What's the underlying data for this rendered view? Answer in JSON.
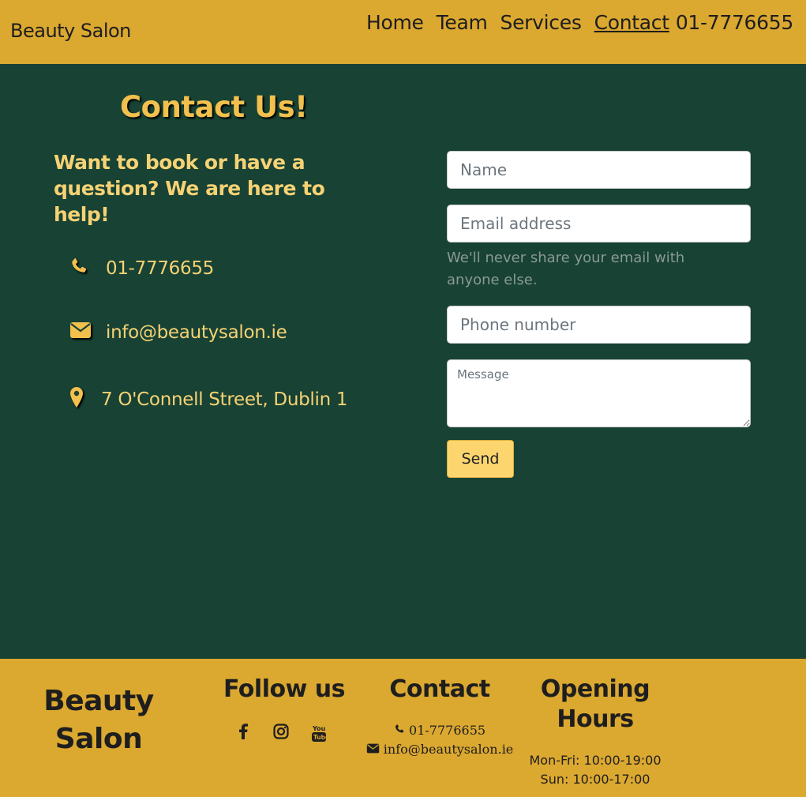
{
  "nav": {
    "brand": "Beauty Salon",
    "links": [
      "Home",
      "Team",
      "Services",
      "Contact"
    ],
    "active": "Contact",
    "phone": "01-7776655"
  },
  "main": {
    "title": "Contact Us!",
    "tagline": "Want to book or have a question? We are here to help!",
    "phone": "01-7776655",
    "email": "info@beautysalon.ie",
    "address": "7 O'Connell Street, Dublin 1",
    "icons": [
      "phone-icon",
      "envelope-icon",
      "map-marker-icon"
    ]
  },
  "form": {
    "name_placeholder": "Name",
    "email_placeholder": "Email address",
    "email_help": "We'll never share your email with anyone else.",
    "phone_placeholder": "Phone number",
    "message_placeholder": "Message",
    "send_label": "Send"
  },
  "footer": {
    "brand": "Beauty Salon",
    "follow_title": "Follow us",
    "social_icons": [
      "facebook-icon",
      "instagram-icon",
      "youtube-icon"
    ],
    "contact_title": "Contact",
    "phone": "01-7776655",
    "email": "info@beautysalon.ie",
    "hours_title": "Opening Hours",
    "hours": [
      "Mon-Fri: 10:00-19:00",
      "Sun: 10:00-17:00"
    ]
  },
  "colors": {
    "primary": "#dba830",
    "background": "#174234",
    "accent_text": "#f7d274",
    "button": "#fcd56f"
  }
}
